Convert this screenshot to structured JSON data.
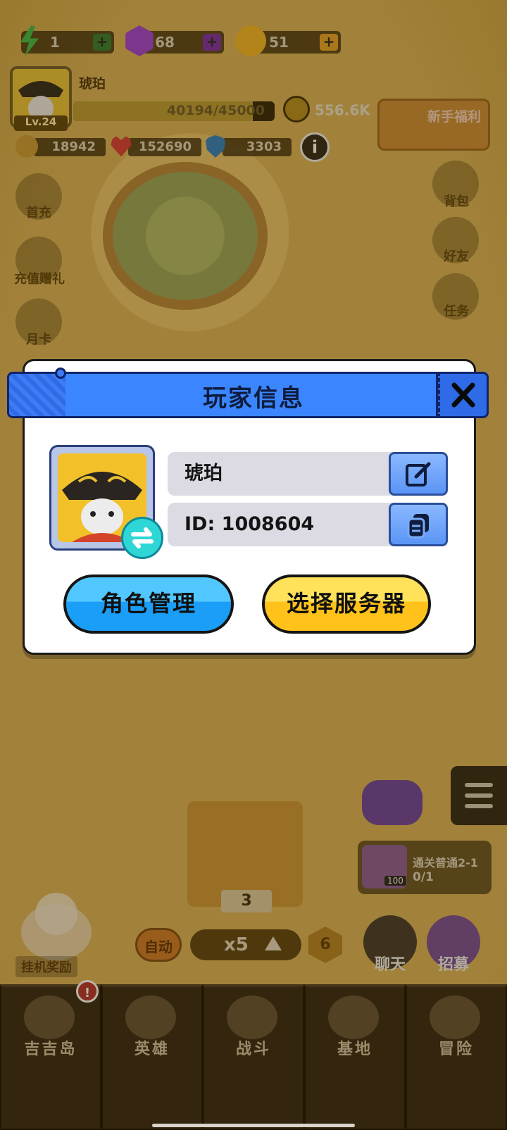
{
  "resources": [
    {
      "name": "energy",
      "icon": "lightning-icon",
      "value": "1",
      "color": "#3bb84a"
    },
    {
      "name": "gem",
      "icon": "purple-gem-icon",
      "value": "68",
      "color": "#9b3fd6"
    },
    {
      "name": "coin",
      "icon": "gold-coin-icon",
      "value": "51",
      "color": "#f2b628"
    }
  ],
  "player": {
    "name": "琥珀",
    "level": "Lv.24",
    "xp_text": "40194/45000",
    "xp_fraction": 0.893,
    "power": "556.6K"
  },
  "stats": {
    "attack": "18942",
    "hp": "152690",
    "defense": "3303"
  },
  "newbie_label": "新手福利",
  "left_menu": [
    "首充",
    "充值赠礼",
    "月卡"
  ],
  "right_menu": [
    "背包",
    "好友",
    "任务"
  ],
  "dialog": {
    "title": "玩家信息",
    "name": "琥珀",
    "id_text": "ID: 1008604",
    "role_button": "角色管理",
    "server_button": "选择服务器"
  },
  "battle": {
    "idle_reward": "挂机奖励",
    "auto": "自动",
    "speed": "x5",
    "level_badge": "6",
    "stage": "3"
  },
  "quest": {
    "title": "通关普通2-1",
    "progress": "0/1",
    "reward_count": "100"
  },
  "round_buttons": [
    "聊天",
    "招募"
  ],
  "nav": [
    "吉吉岛",
    "英雄",
    "战斗",
    "基地",
    "冒险"
  ],
  "badge_mark": "!",
  "info_mark": "i",
  "colors": {
    "dialog_header": "#3b86ff",
    "btn_blue": "#1a9ef7",
    "btn_yellow": "#ffc21a"
  }
}
